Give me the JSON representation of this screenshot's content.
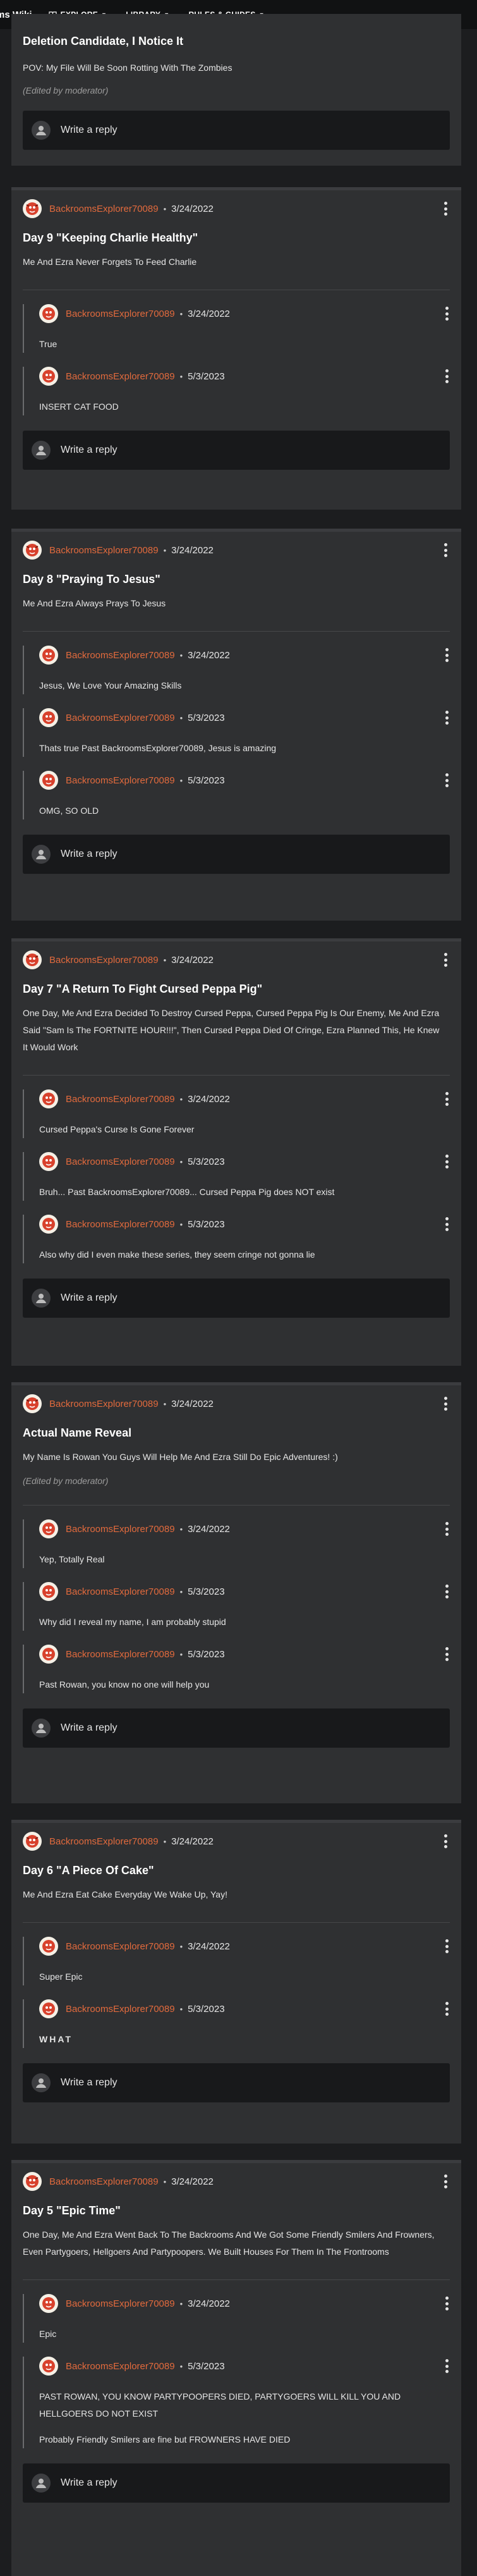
{
  "header": {
    "wiki_title": "ms Wiki",
    "nav": [
      {
        "label": "EXPLORE",
        "icon": "book-icon"
      },
      {
        "label": "LIBRARY"
      },
      {
        "label": "RULES & GUIDES"
      }
    ]
  },
  "write_reply_label": "Write a reply",
  "comments": [
    {
      "title": "Deletion Candidate, I Notice It",
      "body": "POV: My File Will Be Soon Rotting With The Zombies",
      "edited": "(Edited by moderator)",
      "replies": []
    },
    {
      "author": "BackroomsExplorer70089",
      "date": "3/24/2022",
      "title": "Day 9 \"Keeping Charlie Healthy\"",
      "body": "Me And Ezra Never Forgets To Feed Charlie",
      "replies": [
        {
          "author": "BackroomsExplorer70089",
          "date": "3/24/2022",
          "body": "True"
        },
        {
          "author": "BackroomsExplorer70089",
          "date": "5/3/2023",
          "body": "INSERT CAT FOOD"
        }
      ]
    },
    {
      "author": "BackroomsExplorer70089",
      "date": "3/24/2022",
      "title": "Day 8 \"Praying To Jesus\"",
      "body": "Me And Ezra Always Prays To Jesus",
      "replies": [
        {
          "author": "BackroomsExplorer70089",
          "date": "3/24/2022",
          "body": "Jesus, We Love Your Amazing Skills"
        },
        {
          "author": "BackroomsExplorer70089",
          "date": "5/3/2023",
          "body": "Thats true Past BackroomsExplorer70089, Jesus is amazing"
        },
        {
          "author": "BackroomsExplorer70089",
          "date": "5/3/2023",
          "body": "OMG, SO OLD"
        }
      ]
    },
    {
      "author": "BackroomsExplorer70089",
      "date": "3/24/2022",
      "title": "Day 7 \"A Return To Fight Cursed Peppa Pig\"",
      "body": "One Day, Me And Ezra Decided To Destroy Cursed Peppa, Cursed Peppa Pig Is Our Enemy, Me And Ezra Said \"Sam Is The FORTNITE HOUR!!!\", Then Cursed Peppa Died Of Cringe, Ezra Planned This, He Knew It Would Work",
      "replies": [
        {
          "author": "BackroomsExplorer70089",
          "date": "3/24/2022",
          "body": "Cursed Peppa's Curse Is Gone Forever"
        },
        {
          "author": "BackroomsExplorer70089",
          "date": "5/3/2023",
          "body": "Bruh... Past BackroomsExplorer70089... Cursed Peppa Pig does NOT exist"
        },
        {
          "author": "BackroomsExplorer70089",
          "date": "5/3/2023",
          "body": "Also why did I even make these series, they seem cringe not gonna lie"
        }
      ]
    },
    {
      "author": "BackroomsExplorer70089",
      "date": "3/24/2022",
      "title": "Actual Name Reveal",
      "body": "My Name Is Rowan You Guys Will Help Me And Ezra Still Do Epic Adventures! :)",
      "edited": "(Edited by moderator)",
      "replies": [
        {
          "author": "BackroomsExplorer70089",
          "date": "3/24/2022",
          "body": "Yep, Totally Real"
        },
        {
          "author": "BackroomsExplorer70089",
          "date": "5/3/2023",
          "body": "Why did I reveal my name, I am probably stupid"
        },
        {
          "author": "BackroomsExplorer70089",
          "date": "5/3/2023",
          "body": "Past Rowan, you know no one will help you"
        }
      ]
    },
    {
      "author": "BackroomsExplorer70089",
      "date": "3/24/2022",
      "title": "Day 6 \"A Piece Of Cake\"",
      "body": "Me And Ezra Eat Cake Everyday We Wake Up, Yay!",
      "replies": [
        {
          "author": "BackroomsExplorer70089",
          "date": "3/24/2022",
          "body": "Super Epic"
        },
        {
          "author": "BackroomsExplorer70089",
          "date": "5/3/2023",
          "body": "WHAT"
        }
      ]
    },
    {
      "author": "BackroomsExplorer70089",
      "date": "3/24/2022",
      "title": "Day 5 \"Epic Time\"",
      "body": "One Day, Me And Ezra Went Back To The Backrooms And We Got Some Friendly Smilers And Frowners, Even Partygoers, Hellgoers And Partypoopers. We Built Houses For Them In The Frontrooms",
      "replies": [
        {
          "author": "BackroomsExplorer70089",
          "date": "3/24/2022",
          "body": "Epic"
        },
        {
          "author": "BackroomsExplorer70089",
          "date": "5/3/2023",
          "body": "PAST ROWAN, YOU KNOW PARTYPOOPERS DIED, PARTYGOERS WILL KILL YOU AND HELLGOERS DO NOT EXIST",
          "body2": "Probably Friendly Smilers are fine but FROWNERS HAVE DIED"
        }
      ]
    }
  ]
}
